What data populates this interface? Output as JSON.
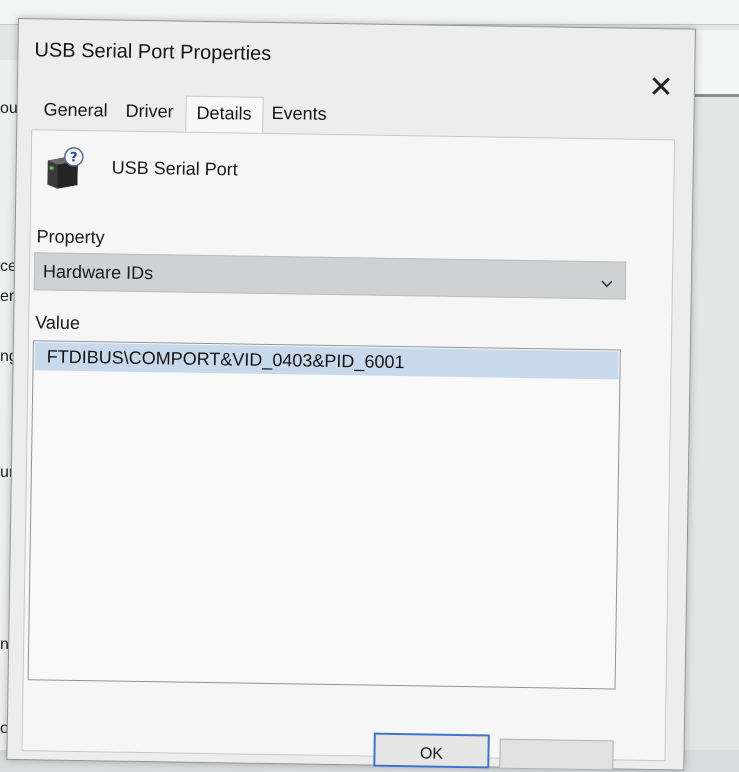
{
  "background": {
    "fragments": [
      "ou",
      "ces",
      "ers",
      "ng",
      "un",
      "ne",
      "ont"
    ]
  },
  "dialog": {
    "title": "USB Serial Port Properties",
    "close_glyph": "✕",
    "tabs": [
      {
        "label": "General",
        "active": false
      },
      {
        "label": "Driver",
        "active": false
      },
      {
        "label": "Details",
        "active": true
      },
      {
        "label": "Events",
        "active": false
      }
    ],
    "device_name": "USB Serial Port",
    "property_label": "Property",
    "property_selected": "Hardware IDs",
    "value_label": "Value",
    "values": [
      "FTDIBUS\\COMPORT&VID_0403&PID_6001"
    ],
    "ok_label": "OK"
  },
  "colors": {
    "selection": "#c9d9ec",
    "focus_border": "#3f74c9",
    "dialog_bg": "#ededed"
  },
  "icons": {
    "device": "usb-device-unknown-icon",
    "close": "close-icon",
    "dropdown": "chevron-down-icon"
  }
}
